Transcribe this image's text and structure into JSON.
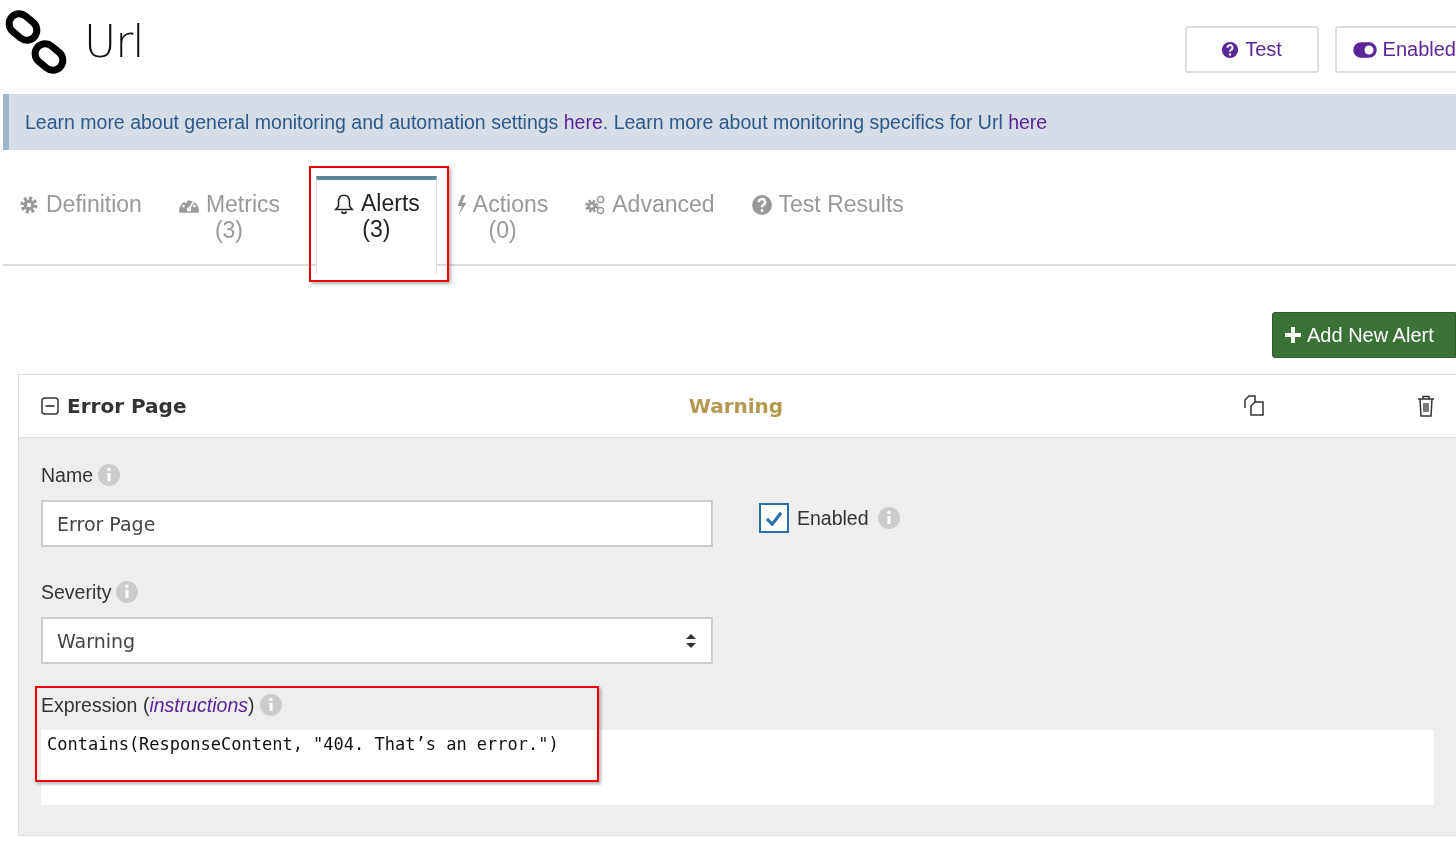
{
  "header": {
    "title": "Url",
    "buttons": [
      {
        "kind": "test",
        "label": "Test"
      },
      {
        "kind": "toggle",
        "label": "Enabled",
        "on": true
      }
    ]
  },
  "banner": {
    "text_1": "Learn more about general monitoring and automation settings ",
    "link_1": "here",
    "text_2": ". Learn more about monitoring specifics for Url ",
    "link_2": "here"
  },
  "tabs": [
    {
      "label": "Definition",
      "selected": false,
      "highlighted": false
    },
    {
      "label": "Metrics",
      "count": "(3)",
      "selected": false,
      "highlighted": false
    },
    {
      "label": "Alerts",
      "count": "(3)",
      "selected": true,
      "highlighted": true
    },
    {
      "label": "Actions",
      "count": "(0)",
      "selected": false,
      "highlighted": false
    },
    {
      "label": "Advanced",
      "selected": false,
      "highlighted": false
    },
    {
      "label": "Test Results",
      "selected": false,
      "highlighted": false
    }
  ],
  "add_button": "Add New Alert",
  "alert": {
    "title": "Error Page",
    "expanded": true,
    "severity_text": "Warning",
    "name": {
      "label": "Name",
      "value": "Error Page"
    },
    "enabled": {
      "label": "Enabled",
      "checked": true
    },
    "severity": {
      "label": "Severity",
      "value": "Warning"
    },
    "expression": {
      "label": "Expression (",
      "link": "instructions",
      "label_end": ")",
      "value": "Contains(ResponseContent, \"404. That’s an error.\")",
      "highlighted": true
    }
  }
}
